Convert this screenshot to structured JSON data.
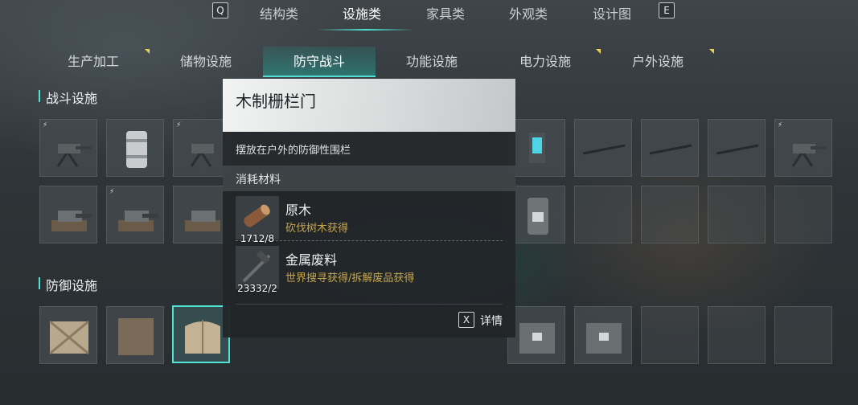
{
  "top_nav": {
    "key_left": "Q",
    "key_right": "E",
    "categories": [
      "结构类",
      "设施类",
      "家具类",
      "外观类",
      "设计图"
    ],
    "active_index": 1
  },
  "sub_tabs": {
    "items": [
      "生产加工",
      "储物设施",
      "防守战斗",
      "功能设施",
      "电力设施",
      "户外设施"
    ],
    "active_index": 2,
    "new_marker_tabs": [
      "生产加工",
      "电力设施",
      "户外设施"
    ]
  },
  "sections": {
    "combat": {
      "title": "战斗设施"
    },
    "defense": {
      "title": "防御设施"
    }
  },
  "tooltip": {
    "title": "木制栅栏门",
    "description": "摆放在户外的防御性围栏",
    "materials_header": "消耗材料",
    "materials": [
      {
        "name": "原木",
        "source": "砍伐树木获得",
        "count": "1712/8",
        "icon": "log-icon"
      },
      {
        "name": "金属废料",
        "source": "世界搜寻获得/拆解废品获得",
        "count": "23332/2",
        "icon": "scrap-metal-icon"
      }
    ],
    "detail_key": "X",
    "detail_label": "详情"
  },
  "colors": {
    "accent": "#52e2d3",
    "source_text": "#c7a64c",
    "new_marker": "#e9d34b"
  }
}
